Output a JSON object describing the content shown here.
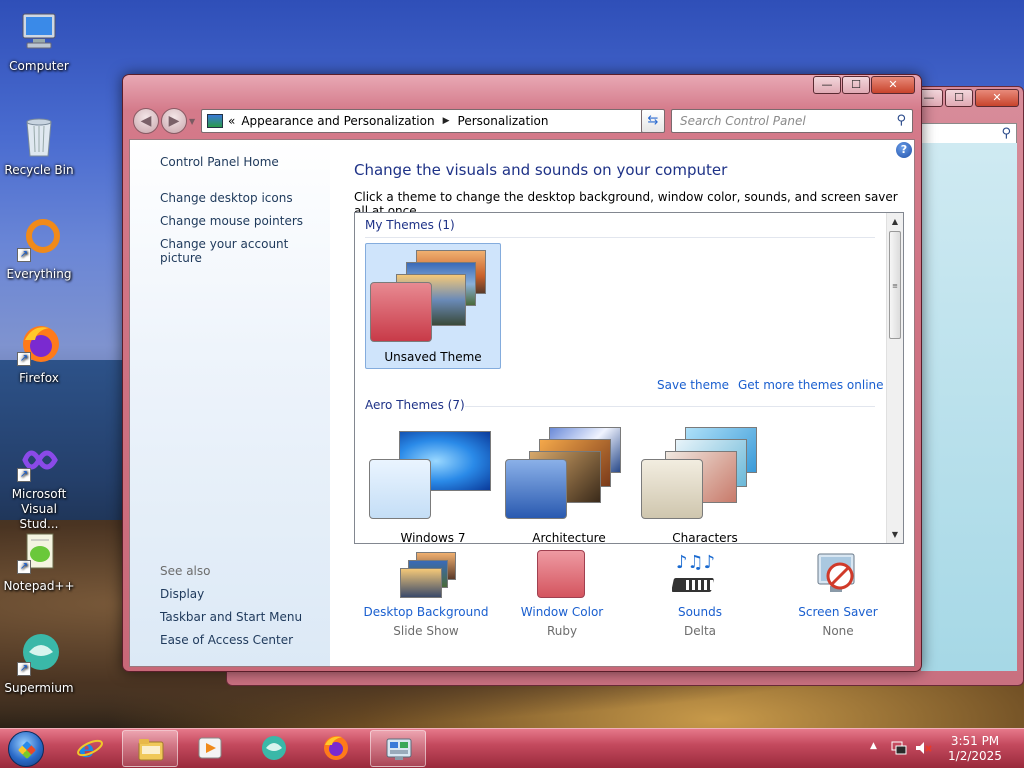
{
  "desktop": {
    "icons": [
      {
        "label": "Computer"
      },
      {
        "label": "Recycle Bin"
      },
      {
        "label": "Everything"
      },
      {
        "label": "Firefox"
      },
      {
        "label": "Microsoft Visual Stud..."
      },
      {
        "label": "Notepad++"
      },
      {
        "label": "Supermium"
      }
    ]
  },
  "window": {
    "address": {
      "overflow": "«",
      "crumb1": "Appearance and Personalization",
      "crumb2": "Personalization"
    },
    "search_placeholder": "Search Control Panel",
    "controls": {
      "minimize": "—",
      "maximize": "☐",
      "close": "✕"
    }
  },
  "left_pane": {
    "home": "Control Panel Home",
    "links": [
      "Change desktop icons",
      "Change mouse pointers",
      "Change your account picture"
    ],
    "see_also_title": "See also",
    "see_also": [
      "Display",
      "Taskbar and Start Menu",
      "Ease of Access Center"
    ]
  },
  "main": {
    "title": "Change the visuals and sounds on your computer",
    "subtitle": "Click a theme to change the desktop background, window color, sounds, and screen saver all at once.",
    "my_themes_title": "My Themes (1)",
    "my_themes": [
      {
        "label": "Unsaved Theme",
        "selected": true,
        "swatch": "#d4555f"
      }
    ],
    "save_theme": "Save theme",
    "get_more": "Get more themes online",
    "aero_title": "Aero Themes (7)",
    "aero_themes": [
      {
        "label": "Windows 7",
        "swatch": "#cfe6fb"
      },
      {
        "label": "Architecture",
        "swatch": "#5a8ad0"
      },
      {
        "label": "Characters",
        "swatch": "#d8d0bc"
      }
    ]
  },
  "bottom": [
    {
      "title": "Desktop Background",
      "sub": "Slide Show",
      "icon": "wallpaper-icon"
    },
    {
      "title": "Window Color",
      "sub": "Ruby",
      "icon": "window-color-icon",
      "color": "#d4555f"
    },
    {
      "title": "Sounds",
      "sub": "Delta",
      "icon": "sounds-icon"
    },
    {
      "title": "Screen Saver",
      "sub": "None",
      "icon": "screen-saver-icon"
    }
  ],
  "taskbar": {
    "clock_time": "3:51 PM",
    "clock_date": "1/2/2025",
    "tray_arrow": "▲"
  },
  "colors": {
    "accent_ruby": "#c44a5e",
    "link_blue": "#1a5fcf",
    "heading_blue": "#1e3287"
  }
}
